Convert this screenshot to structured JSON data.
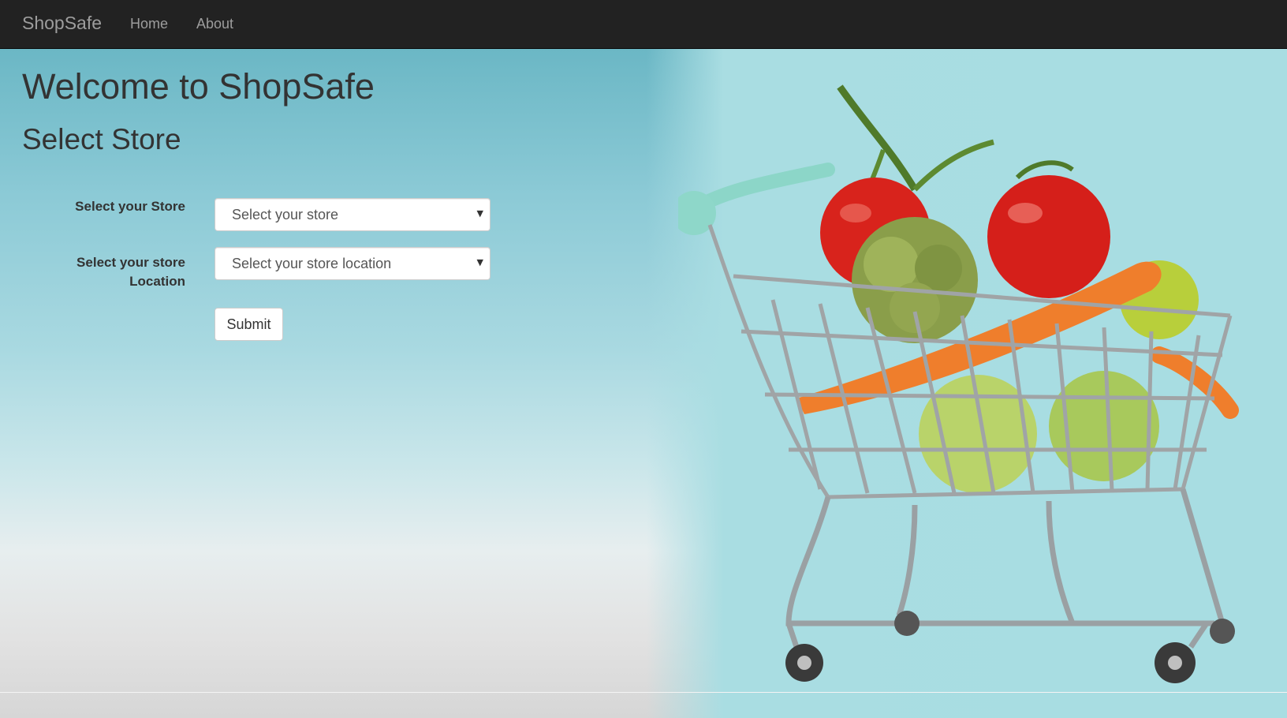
{
  "navbar": {
    "brand": "ShopSafe",
    "links": [
      {
        "label": "Home"
      },
      {
        "label": "About"
      }
    ]
  },
  "main": {
    "title": "Welcome to ShopSafe",
    "subtitle": "Select Store"
  },
  "form": {
    "store": {
      "label": "Select your Store",
      "value": "Select your store"
    },
    "location": {
      "label": "Select your store Location",
      "value": "Select your store location"
    },
    "submit_label": "Submit"
  },
  "hero_image": {
    "subject": "shopping cart with vegetables",
    "icon": "shopping-cart-illustration"
  },
  "colors": {
    "navbar_bg": "#222222",
    "nav_text": "#9d9d9d",
    "heading_text": "#333333",
    "hero_teal": "#a8dde2"
  }
}
